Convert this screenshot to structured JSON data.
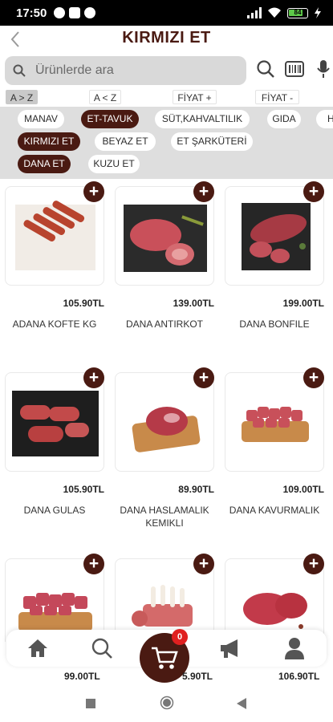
{
  "status_bar": {
    "time": "17:50",
    "battery": "84"
  },
  "header": {
    "title": "KIRMIZI ET"
  },
  "search": {
    "placeholder": "Ürünlerde ara"
  },
  "sort": [
    {
      "label": "A > Z",
      "active": true
    },
    {
      "label": "A < Z",
      "active": false
    },
    {
      "label": "FİYAT +",
      "active": false
    },
    {
      "label": "FİYAT -",
      "active": false
    }
  ],
  "categories_row1": [
    {
      "label": "MANAV",
      "selected": false
    },
    {
      "label": "ET-TAVUK",
      "selected": true
    },
    {
      "label": "SÜT,KAHVALTILIK",
      "selected": false
    },
    {
      "label": "GIDA",
      "selected": false
    },
    {
      "label": "Hİ",
      "selected": false
    }
  ],
  "categories_row2": [
    {
      "label": "KIRMIZI ET",
      "selected": true
    },
    {
      "label": "BEYAZ ET",
      "selected": false
    },
    {
      "label": "ET ŞARKÜTERİ",
      "selected": false
    }
  ],
  "categories_row3": [
    {
      "label": "DANA ET",
      "selected": true
    },
    {
      "label": "KUZU ET",
      "selected": false
    }
  ],
  "products": [
    {
      "name": "ADANA KOFTE KG",
      "price": "105.90TL",
      "image": "adana-kofte"
    },
    {
      "name": "DANA ANTIRKOT",
      "price": "139.00TL",
      "image": "steak-plate"
    },
    {
      "name": "DANA BONFILE",
      "price": "199.00TL",
      "image": "fillet-dark"
    },
    {
      "name": "DANA GULAS",
      "price": "105.90TL",
      "image": "gulas-dark"
    },
    {
      "name": "DANA HASLAMALIK KEMIKLI",
      "price": "89.90TL",
      "image": "board-chunk"
    },
    {
      "name": "DANA KAVURMALIK",
      "price": "109.00TL",
      "image": "board-cubes"
    },
    {
      "name": "",
      "price": "99.00TL",
      "image": "cubes-board"
    },
    {
      "name": "",
      "price": "5.90TL",
      "image": "lamb-rack"
    },
    {
      "name": "",
      "price": "106.90TL",
      "image": "steak-raw"
    }
  ],
  "cart": {
    "count": "0"
  },
  "icons": {
    "back": "chevron-left-icon",
    "search": "search-icon",
    "barcode": "barcode-icon",
    "mic": "mic-icon",
    "home": "home-icon",
    "nav_search": "search-icon",
    "cart": "cart-icon",
    "campaign": "megaphone-icon",
    "profile": "user-icon"
  },
  "colors": {
    "brand": "#4a1a12",
    "badge": "#e02020",
    "panel": "#dedede"
  }
}
